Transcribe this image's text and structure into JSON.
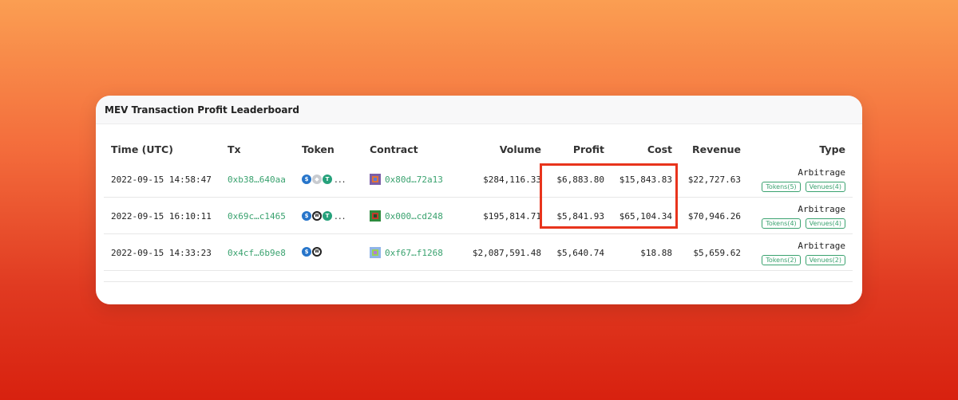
{
  "title": "MEV Transaction Profit Leaderboard",
  "columns": {
    "time": "Time (UTC)",
    "tx": "Tx",
    "token": "Token",
    "contract": "Contract",
    "volume": "Volume",
    "profit": "Profit",
    "cost": "Cost",
    "revenue": "Revenue",
    "type": "Type"
  },
  "rows": [
    {
      "time": "2022-09-15 14:58:47",
      "tx": "0xb38…640aa",
      "tokens": [
        "usdc-icon",
        "eth-icon",
        "usdt-icon"
      ],
      "more_tokens": "...",
      "contract": "0x80d…72a13",
      "volume": "$284,116.33",
      "profit": "$6,883.80",
      "cost": "$15,843.83",
      "revenue": "$22,727.63",
      "type": "Arbitrage",
      "tokens_badge": "Tokens(5)",
      "venues_badge": "Venues(4)"
    },
    {
      "time": "2022-09-15 16:10:11",
      "tx": "0x69c…c1465",
      "tokens": [
        "usdc-icon",
        "wbtc-icon",
        "usdt-icon"
      ],
      "more_tokens": "...",
      "contract": "0x000…cd248",
      "volume": "$195,814.71",
      "profit": "$5,841.93",
      "cost": "$65,104.34",
      "revenue": "$70,946.26",
      "type": "Arbitrage",
      "tokens_badge": "Tokens(4)",
      "venues_badge": "Venues(4)"
    },
    {
      "time": "2022-09-15 14:33:23",
      "tx": "0x4cf…6b9e8",
      "tokens": [
        "usdc-icon",
        "wbtc-icon"
      ],
      "more_tokens": "",
      "contract": "0xf67…f1268",
      "volume": "$2,087,591.48",
      "profit": "$5,640.74",
      "cost": "$18.88",
      "revenue": "$5,659.62",
      "type": "Arbitrage",
      "tokens_badge": "Tokens(2)",
      "venues_badge": "Venues(2)"
    }
  ],
  "colors": {
    "link": "#3aa26f",
    "highlight": "#e8341c"
  }
}
